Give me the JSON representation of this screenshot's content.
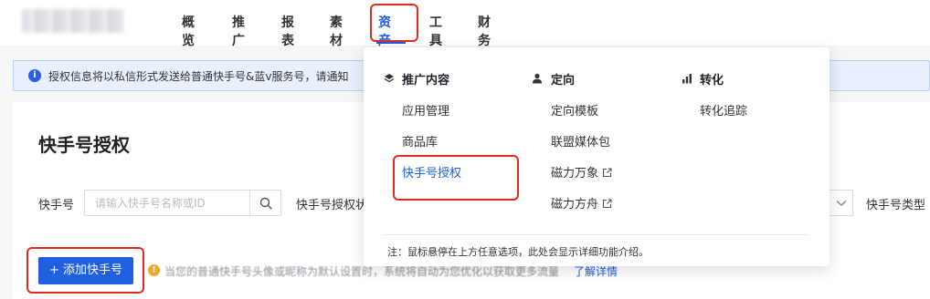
{
  "nav": {
    "items": [
      {
        "label": "概览"
      },
      {
        "label": "推广"
      },
      {
        "label": "报表"
      },
      {
        "label": "素材"
      },
      {
        "label": "资产",
        "active": true
      },
      {
        "label": "工具"
      },
      {
        "label": "财务"
      }
    ]
  },
  "notice": {
    "icon": "info-icon",
    "text": "授权信息将以私信形式发送给普通快手号&蓝v服务号，请通知"
  },
  "page": {
    "title": "快手号授权"
  },
  "filters": {
    "kuaishou_label": "快手号",
    "search_placeholder": "请输入快手号名称或ID",
    "auth_status_label": "快手号授权状",
    "type_label": "快手号类型"
  },
  "actions": {
    "add_button": "+ 添加快手号"
  },
  "tip": {
    "text": "当您的普通快手号头像或昵称为默认设置时，系统将自动为您优化以获取更多流量",
    "link": "了解详情"
  },
  "dropdown": {
    "columns": [
      {
        "title": "推广内容",
        "icon": "layers-icon",
        "items": [
          {
            "label": "应用管理"
          },
          {
            "label": "商品库"
          },
          {
            "label": "快手号授权",
            "active": true
          }
        ]
      },
      {
        "title": "定向",
        "icon": "person-icon",
        "items": [
          {
            "label": "定向模板"
          },
          {
            "label": "联盟媒体包"
          },
          {
            "label": "磁力万象",
            "external": true
          },
          {
            "label": "磁力方舟",
            "external": true
          }
        ]
      },
      {
        "title": "转化",
        "icon": "bar-chart-icon",
        "items": [
          {
            "label": "转化追踪"
          }
        ]
      }
    ],
    "note": "注：鼠标悬停在上方任意选项，此处会显示详细功能介绍。"
  },
  "highlight_color": "#e02b20",
  "accent_color": "#1a5ee6"
}
